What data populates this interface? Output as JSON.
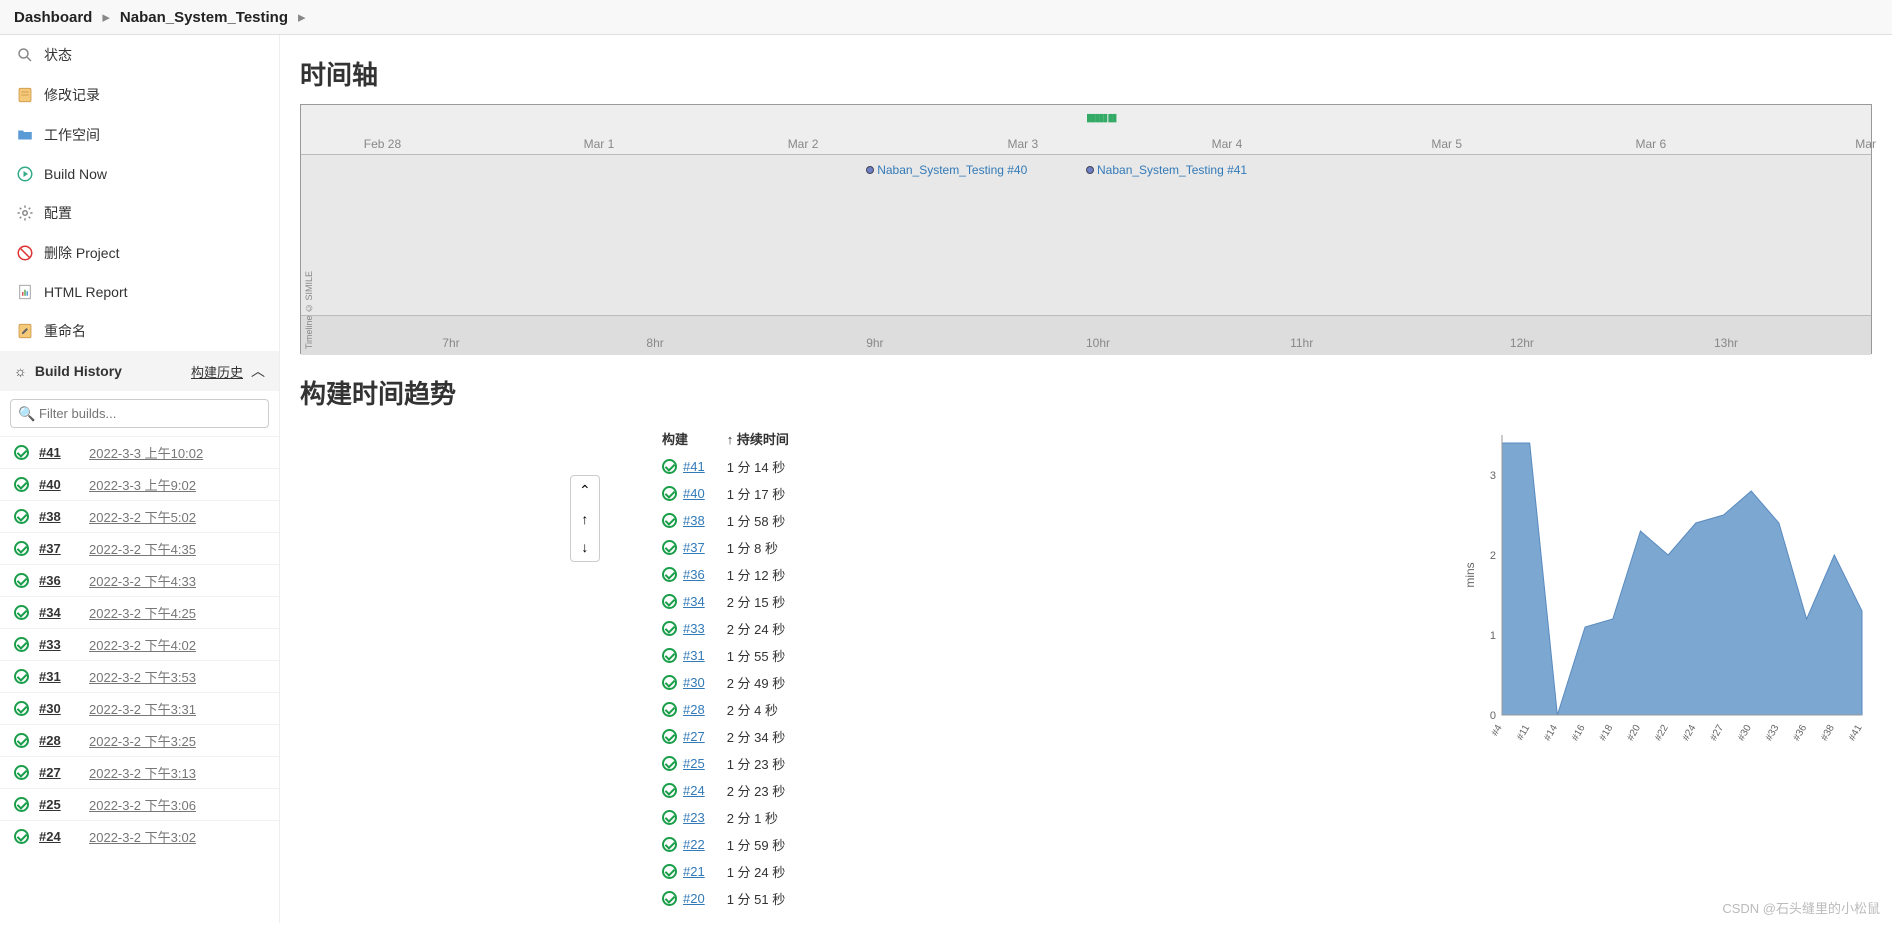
{
  "breadcrumb": {
    "dashboard": "Dashboard",
    "project": "Naban_System_Testing"
  },
  "sidebar": {
    "items": [
      {
        "label": "状态",
        "icon": "search"
      },
      {
        "label": "修改记录",
        "icon": "notes"
      },
      {
        "label": "工作空间",
        "icon": "folder"
      },
      {
        "label": "Build Now",
        "icon": "play"
      },
      {
        "label": "配置",
        "icon": "gear"
      },
      {
        "label": "删除 Project",
        "icon": "forbid"
      },
      {
        "label": "HTML Report",
        "icon": "report"
      },
      {
        "label": "重命名",
        "icon": "rename"
      }
    ]
  },
  "buildHistory": {
    "title": "Build History",
    "trendLabel": "构建历史",
    "filterPlaceholder": "Filter builds...",
    "items": [
      {
        "num": "#41",
        "time": "2022-3-3 上午10:02"
      },
      {
        "num": "#40",
        "time": "2022-3-3 上午9:02"
      },
      {
        "num": "#38",
        "time": "2022-3-2 下午5:02"
      },
      {
        "num": "#37",
        "time": "2022-3-2 下午4:35"
      },
      {
        "num": "#36",
        "time": "2022-3-2 下午4:33"
      },
      {
        "num": "#34",
        "time": "2022-3-2 下午4:25"
      },
      {
        "num": "#33",
        "time": "2022-3-2 下午4:02"
      },
      {
        "num": "#31",
        "time": "2022-3-2 下午3:53"
      },
      {
        "num": "#30",
        "time": "2022-3-2 下午3:31"
      },
      {
        "num": "#28",
        "time": "2022-3-2 下午3:25"
      },
      {
        "num": "#27",
        "time": "2022-3-2 下午3:13"
      },
      {
        "num": "#25",
        "time": "2022-3-2 下午3:06"
      },
      {
        "num": "#24",
        "time": "2022-3-2 下午3:02"
      }
    ]
  },
  "timeline": {
    "title": "时间轴",
    "dates": [
      "Feb 28",
      "Mar 1",
      "Mar 2",
      "Mar 3",
      "Mar 4",
      "Mar 5",
      "Mar 6",
      "Mar"
    ],
    "hours": [
      "7hr",
      "8hr",
      "9hr",
      "10hr",
      "11hr",
      "12hr",
      "13hr"
    ],
    "events": [
      {
        "label": "Naban_System_Testing #40",
        "pos": 36
      },
      {
        "label": "Naban_System_Testing #41",
        "pos": 50
      }
    ],
    "credit": "Timeline © SIMILE"
  },
  "trend": {
    "title": "构建时间趋势",
    "headers": {
      "build": "构建",
      "duration": "↑ 持续时间"
    },
    "rows": [
      {
        "n": "#41",
        "d": "1 分 14 秒"
      },
      {
        "n": "#40",
        "d": "1 分 17 秒"
      },
      {
        "n": "#38",
        "d": "1 分 58 秒"
      },
      {
        "n": "#37",
        "d": "1 分 8 秒"
      },
      {
        "n": "#36",
        "d": "1 分 12 秒"
      },
      {
        "n": "#34",
        "d": "2 分 15 秒"
      },
      {
        "n": "#33",
        "d": "2 分 24 秒"
      },
      {
        "n": "#31",
        "d": "1 分 55 秒"
      },
      {
        "n": "#30",
        "d": "2 分 49 秒"
      },
      {
        "n": "#28",
        "d": "2 分 4 秒"
      },
      {
        "n": "#27",
        "d": "2 分 34 秒"
      },
      {
        "n": "#25",
        "d": "1 分 23 秒"
      },
      {
        "n": "#24",
        "d": "2 分 23 秒"
      },
      {
        "n": "#23",
        "d": "2 分 1 秒"
      },
      {
        "n": "#22",
        "d": "1 分 59 秒"
      },
      {
        "n": "#21",
        "d": "1 分 24 秒"
      },
      {
        "n": "#20",
        "d": "1 分 51 秒"
      }
    ]
  },
  "chart_data": {
    "type": "area",
    "title": "",
    "ylabel": "mins",
    "xlabel": "",
    "ylim": [
      0,
      3.5
    ],
    "yticks": [
      0,
      1,
      2,
      3
    ],
    "categories": [
      "#4",
      "#11",
      "#14",
      "#16",
      "#18",
      "#20",
      "#22",
      "#24",
      "#27",
      "#30",
      "#33",
      "#36",
      "#38",
      "#41"
    ],
    "series": [
      {
        "name": "duration",
        "values": [
          3.4,
          3.4,
          0.0,
          1.1,
          1.2,
          2.3,
          2.0,
          2.4,
          2.5,
          2.8,
          2.4,
          1.2,
          2.0,
          1.3
        ]
      }
    ]
  },
  "watermark": "CSDN @石头缝里的小松鼠"
}
